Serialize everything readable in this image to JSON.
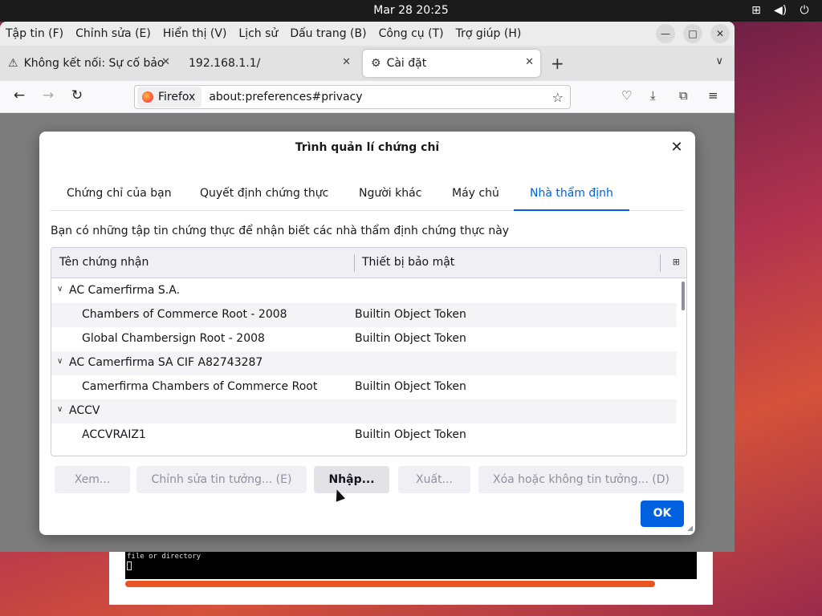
{
  "topbar": {
    "datetime": "Mar 28  20:25",
    "icons": [
      "network-icon",
      "volume-icon",
      "power-icon"
    ]
  },
  "firefox": {
    "menu": [
      "Tập tin (F)",
      "Chỉnh sửa (E)",
      "Hiển thị (V)",
      "Lịch sử",
      "Dấu trang (B)",
      "Công cụ (T)",
      "Trợ giúp (H)"
    ],
    "tabs": [
      {
        "label": "Không kết nối: Sự cố bảo",
        "icon": "warning-icon"
      },
      {
        "label": "192.168.1.1/"
      },
      {
        "label": "Cài đặt",
        "icon": "gear-icon"
      }
    ],
    "url_badge": "Firefox",
    "url": "about:preferences#privacy"
  },
  "dialog": {
    "title": "Trình quản lí chứng chỉ",
    "tabs": [
      "Chứng chỉ của bạn",
      "Quyết định chứng thực",
      "Người khác",
      "Máy chủ",
      "Nhà thẩm định"
    ],
    "active_tab": "Nhà thẩm định",
    "description": "Bạn có những tập tin chứng thực để nhận biết các nhà thẩm định chứng thực này",
    "columns": [
      "Tên chứng nhận",
      "Thiết bị bảo mật"
    ],
    "rows": [
      {
        "type": "group",
        "name": "AC Camerfirma S.A.",
        "token": ""
      },
      {
        "type": "item",
        "name": "Chambers of Commerce Root - 2008",
        "token": "Builtin Object Token"
      },
      {
        "type": "item",
        "name": "Global Chambersign Root - 2008",
        "token": "Builtin Object Token"
      },
      {
        "type": "group",
        "name": "AC Camerfirma SA CIF A82743287",
        "token": ""
      },
      {
        "type": "item",
        "name": "Camerfirma Chambers of Commerce Root",
        "token": "Builtin Object Token"
      },
      {
        "type": "group",
        "name": "ACCV",
        "token": ""
      },
      {
        "type": "item",
        "name": "ACCVRAIZ1",
        "token": "Builtin Object Token"
      }
    ],
    "buttons": {
      "view": "Xem...",
      "edit": "Chỉnh sửa tin tưởng... (E)",
      "import": "Nhập...",
      "export": "Xuất...",
      "delete": "Xóa hoặc không tin tưởng... (D)",
      "ok": "OK"
    }
  },
  "terminal": {
    "text": "file or directory"
  },
  "colors": {
    "accent": "#0061e0",
    "ubuntu_orange": "#e95420"
  }
}
